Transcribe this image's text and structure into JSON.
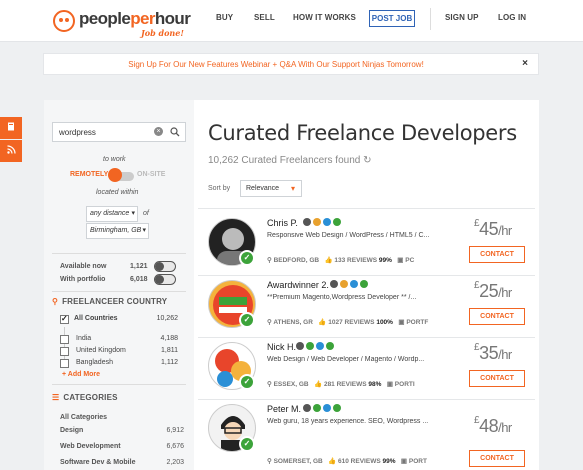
{
  "header": {
    "logo_main": "people",
    "logo_hl": "per",
    "logo_end": "hour",
    "logo_tagline": "Job done!",
    "nav": [
      "BUY",
      "SELL",
      "HOW IT WORKS"
    ],
    "post_job": "POST JOB",
    "sign_up": "SIGN UP",
    "log_in": "LOG IN"
  },
  "banner": {
    "text": "Sign Up For Our New Features Webinar + Q&A With Our Support Ninjas Tomorrow!",
    "close": "×"
  },
  "sidebar": {
    "search_value": "wordpress",
    "to_work": "to work",
    "remotely": "REMOTELY",
    "onsite": "ON-SITE",
    "located_within": "located within",
    "distance": "any distance",
    "of": "of",
    "location": "Birmingham, GB",
    "available_now": {
      "label": "Available now",
      "count": "1,121"
    },
    "with_portfolio": {
      "label": "With portfolio",
      "count": "6,018"
    },
    "country_heading": "FREELANCEER COUNTRY",
    "all_countries": {
      "label": "All Countries",
      "count": "10,262"
    },
    "countries": [
      {
        "label": "India",
        "count": "4,188"
      },
      {
        "label": "United Kingdom",
        "count": "1,811"
      },
      {
        "label": "Bangladesh",
        "count": "1,112"
      }
    ],
    "add_more": "+ Add More",
    "categories_heading": "CATEGORIES",
    "all_categories": "All Categories",
    "categories": [
      {
        "label": "Design",
        "count": "6,912"
      },
      {
        "label": "Web Development",
        "count": "6,676"
      },
      {
        "label": "Software Dev & Mobile",
        "count": "2,203"
      }
    ]
  },
  "main": {
    "title": "Curated Freelance Developers",
    "subtitle": "10,262 Curated Freelancers found",
    "sort_label": "Sort by",
    "sort_value": "Relevance",
    "contact_label": "CONTACT",
    "freelancers": [
      {
        "name": "Chris P.",
        "desc": "Responsive Web Design / WordPress / HTML5 / C...",
        "location": "BEDFORD, GB",
        "reviews": "133 REVIEWS",
        "pct": "99%",
        "extra": "PC",
        "rate": "45",
        "avatar_color": "#d9d9d9"
      },
      {
        "name": "Awardwinner 2.",
        "desc": "**Premium Magento,Wordpress Developer ** /...",
        "location": "ATHENS, GR",
        "reviews": "1027 REVIEWS",
        "pct": "100%",
        "extra": "PORTF",
        "rate": "25",
        "avatar_color": "#f4b23c"
      },
      {
        "name": "Nick H.",
        "desc": "Web Design / Web Developer / Magento / Wordp...",
        "location": "ESSEX, GB",
        "reviews": "281 REVIEWS",
        "pct": "98%",
        "extra": "PORTI",
        "rate": "35",
        "avatar_color": "#e8452b"
      },
      {
        "name": "Peter M.",
        "desc": "Web guru, 18 years experience. SEO, Wordpress ...",
        "location": "SOMERSET, GB",
        "reviews": "610 REVIEWS",
        "pct": "99%",
        "extra": "PORT",
        "rate": "48",
        "avatar_color": "#f2f2f2"
      }
    ],
    "currency": "£",
    "per_hour": "/hr"
  }
}
